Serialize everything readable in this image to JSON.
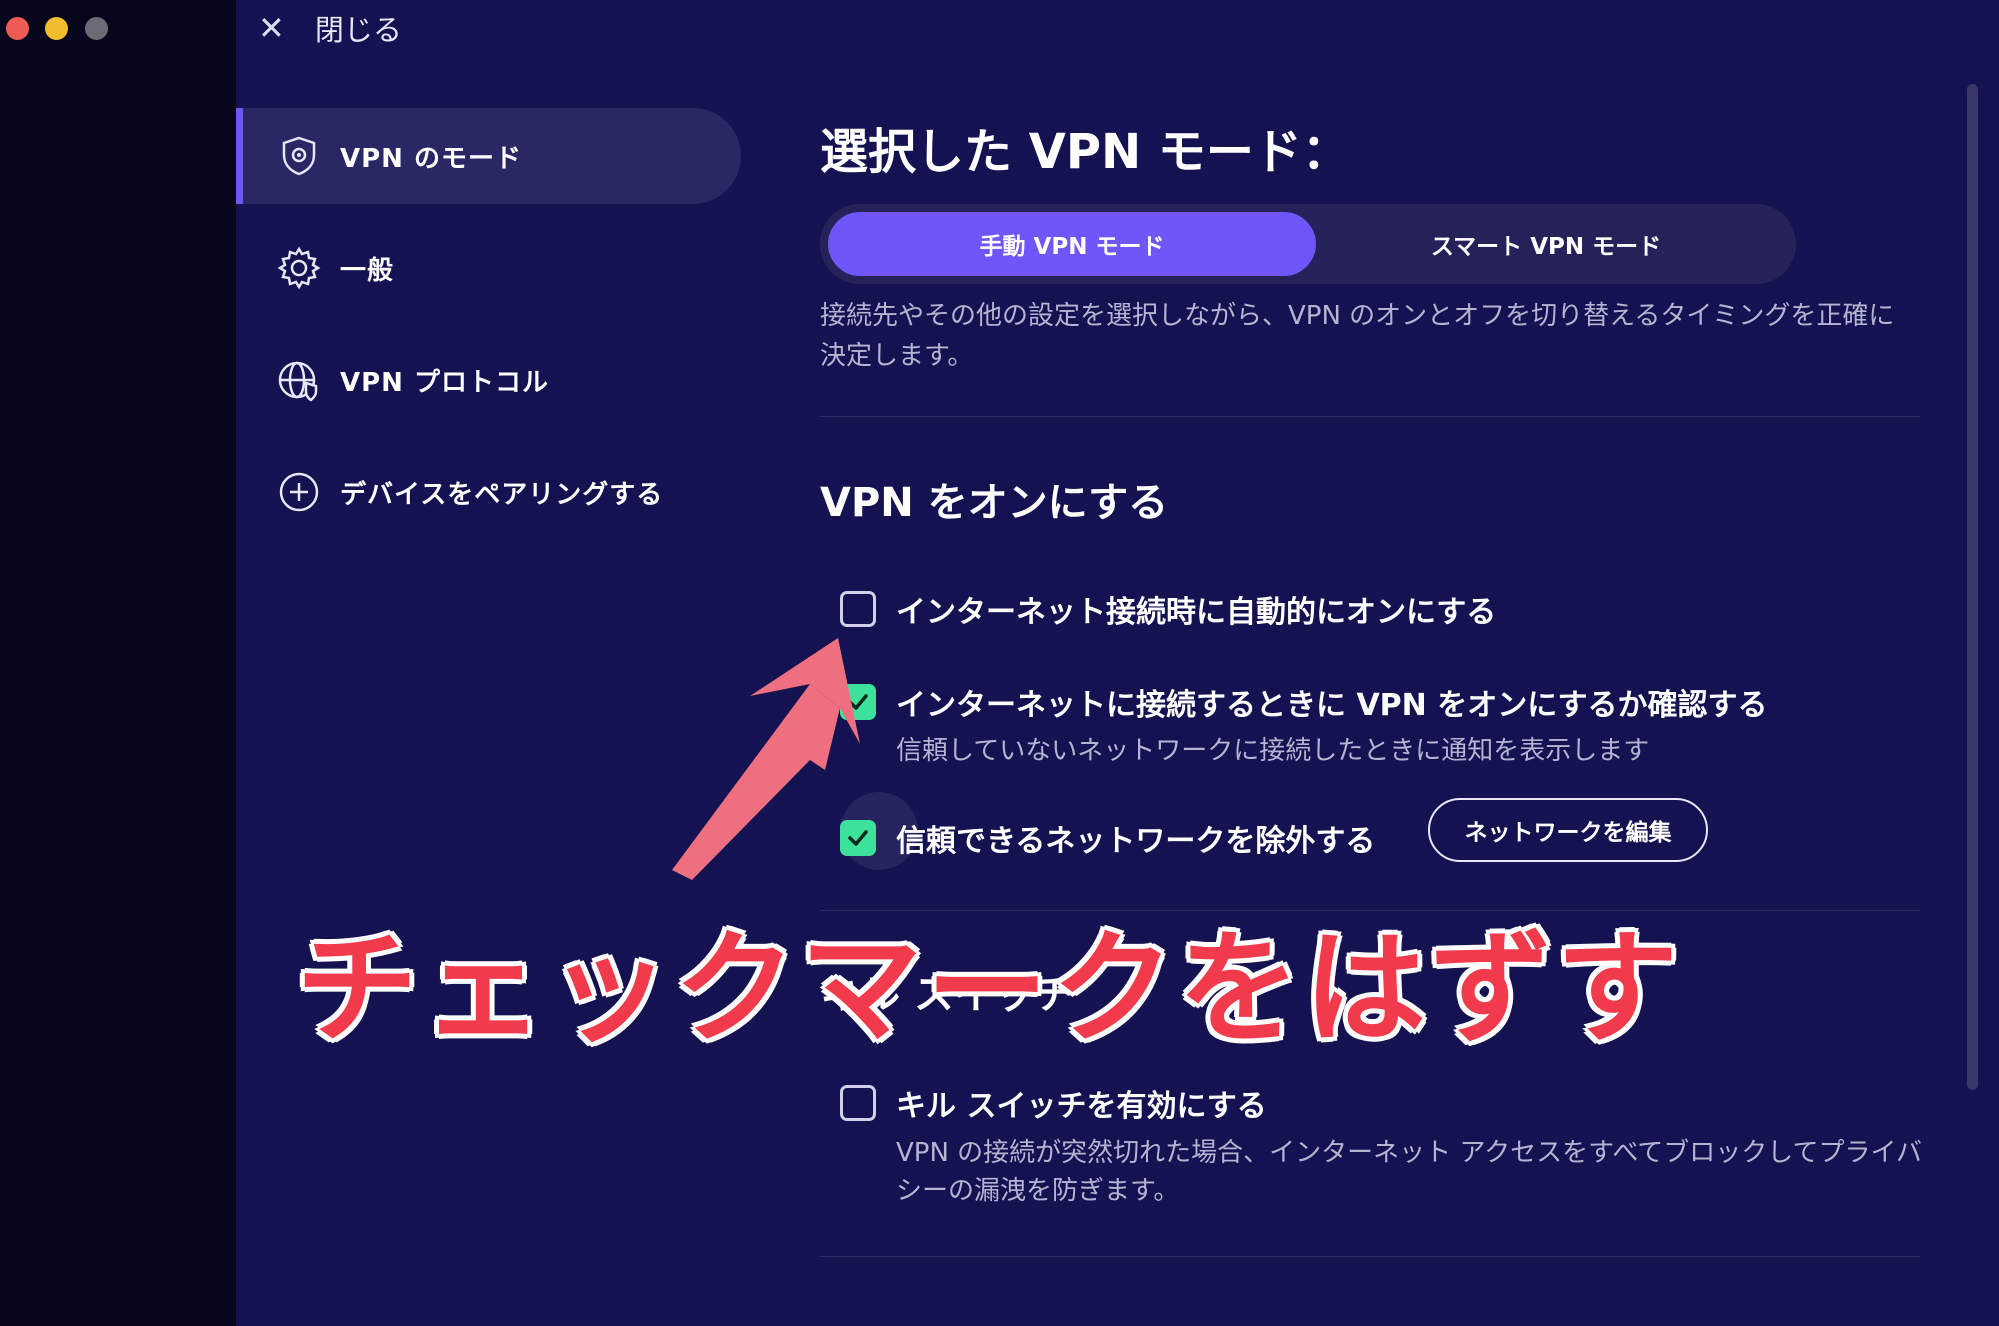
{
  "close": {
    "label": "閉じる"
  },
  "sidebar": {
    "items": [
      {
        "label": "VPN のモード",
        "icon": "shield-gear-icon",
        "active": true
      },
      {
        "label": "一般",
        "icon": "gear-icon",
        "active": false
      },
      {
        "label": "VPN プロトコル",
        "icon": "globe-shield-icon",
        "active": false
      },
      {
        "label": "デバイスをペアリングする",
        "icon": "plus-circle-icon",
        "active": false
      }
    ]
  },
  "main": {
    "title": "選択した VPN モード：",
    "modes": [
      {
        "label": "手動 VPN モード",
        "selected": true
      },
      {
        "label": "スマート VPN モード",
        "selected": false
      }
    ],
    "mode_description": "接続先やその他の設定を選択しながら、VPN のオンとオフを切り替えるタイミングを正確に決定します。",
    "vpn_on_section": {
      "heading": "VPN をオンにする",
      "options": [
        {
          "label": "インターネット接続時に自動的にオンにする",
          "checked": false
        },
        {
          "label": "インターネットに接続するときに VPN をオンにするか確認する",
          "checked": true,
          "subtext": "信頼していないネットワークに接続したときに通知を表示します"
        },
        {
          "label": "信頼できるネットワークを除外する",
          "checked": true
        }
      ],
      "edit_networks_button": "ネットワークを編集"
    },
    "kill_switch_section": {
      "heading": "キル スイッチ",
      "option": {
        "label": "キル スイッチを有効にする",
        "checked": false,
        "subtext": "VPN の接続が突然切れた場合、インターネット アクセスをすべてブロックしてプライバシーの漏洩を防ぎます。"
      }
    }
  },
  "annotation": {
    "text": "チェックマークをはずす",
    "color": "#f13b4c"
  },
  "colors": {
    "background": "#141250",
    "accent": "#6e56f8",
    "check": "#3ee19b"
  }
}
